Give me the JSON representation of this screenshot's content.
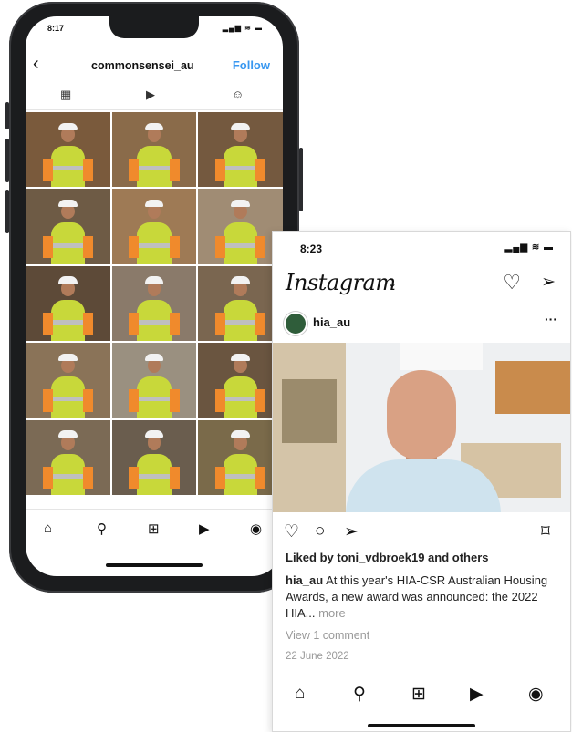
{
  "phone1": {
    "status_time": "8:17",
    "status_icons": "▂▄▆ ≋ ▬",
    "back_label": "‹",
    "username": "commonsensei_au",
    "follow_label": "Follow",
    "tab_icons": [
      "grid-icon",
      "reels-icon",
      "tagged-icon"
    ],
    "tab_glyphs": [
      "▦",
      "▶",
      "☺"
    ],
    "grid": [
      {
        "bg": "#7a5a3c"
      },
      {
        "bg": "#8a6b4a"
      },
      {
        "bg": "#74593f"
      },
      {
        "bg": "#6e5b45"
      },
      {
        "bg": "#9e7a55"
      },
      {
        "bg": "#a08c74"
      },
      {
        "bg": "#5d4a38"
      },
      {
        "bg": "#8a7a6a"
      },
      {
        "bg": "#7a6650"
      },
      {
        "bg": "#8a7358"
      },
      {
        "bg": "#9a9080"
      },
      {
        "bg": "#6a5540"
      },
      {
        "bg": "#7b6a55"
      },
      {
        "bg": "#6a5d4e"
      },
      {
        "bg": "#7a6a4a"
      }
    ],
    "nav_glyphs": [
      "⌂",
      "⚲",
      "⊞",
      "▶",
      "◉"
    ]
  },
  "phone2": {
    "status_time": "8:23",
    "status_icons": "▂▄▆ ≋ ▬",
    "logo": "Instagram",
    "logo_chevron": "⌄",
    "heart_glyph": "♡",
    "send_glyph": "➢",
    "post_username": "hia_au",
    "post_more": "···",
    "action_glyphs": {
      "like": "♡",
      "comment": "○",
      "share": "➢",
      "save": "⌑"
    },
    "liked_by": "Liked by toni_vdbroek19 and others",
    "caption_user": "hia_au",
    "caption_text": " At this year's HIA-CSR Australian Housing Awards, a new award was announced: the 2022 HIA...",
    "caption_more": " more",
    "view_comments": "View 1 comment",
    "date": "22 June 2022",
    "nav_glyphs": [
      "⌂",
      "⚲",
      "⊞",
      "▶",
      "◉"
    ]
  },
  "colors": {
    "follow_blue": "#3897f0",
    "phone_frame": "#1b1c1e"
  }
}
